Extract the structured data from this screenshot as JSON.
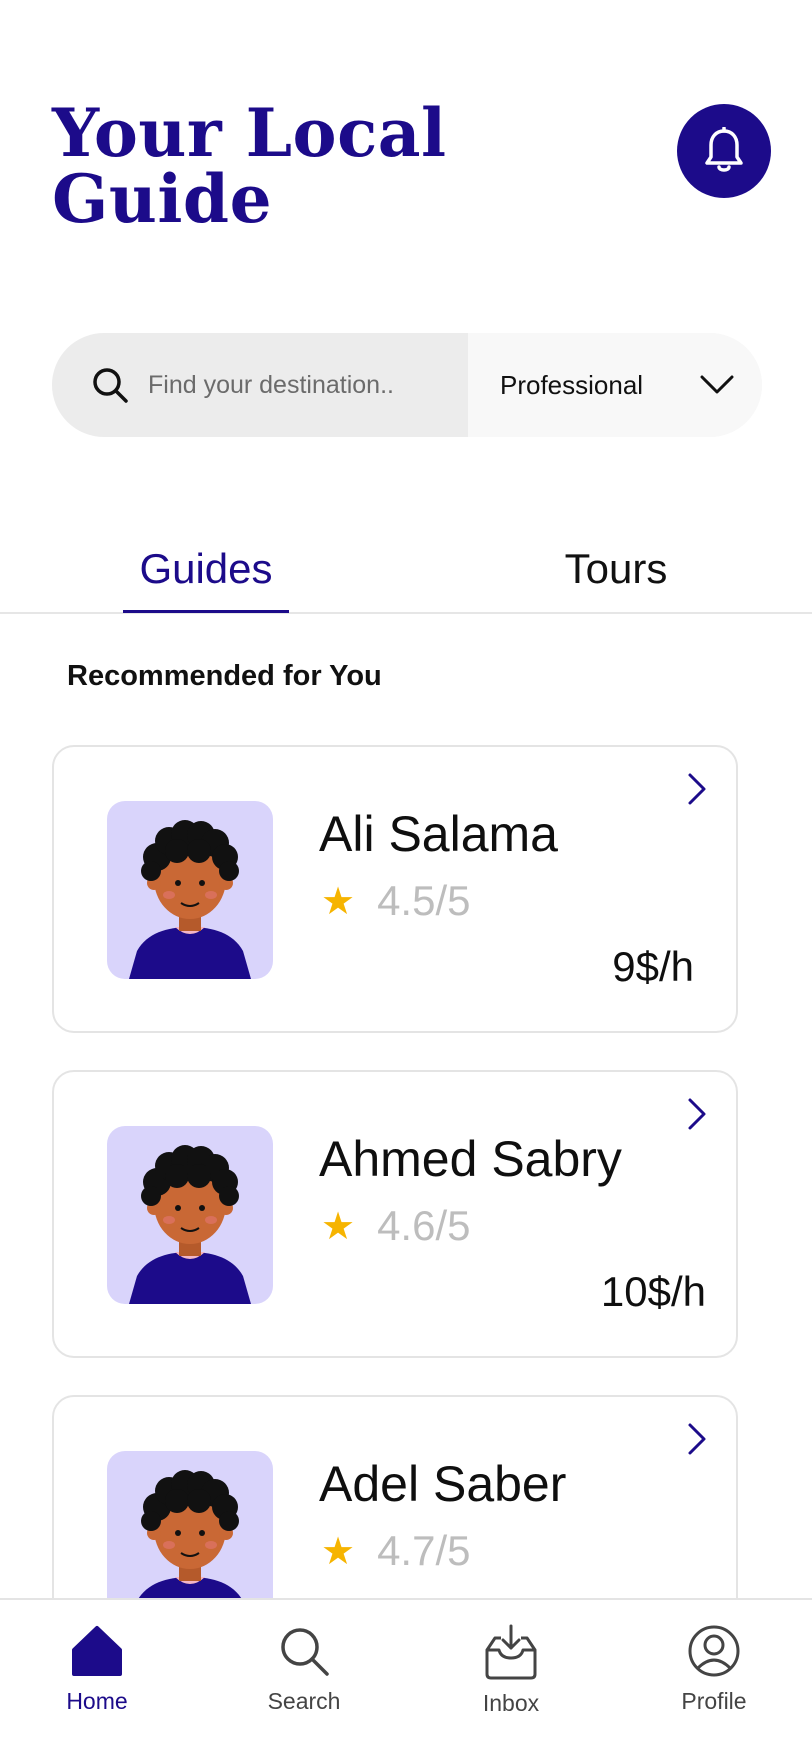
{
  "header": {
    "title_line1": "Your Local",
    "title_line2": "Guide",
    "notification_icon": "bell-icon"
  },
  "search": {
    "placeholder": "Find your destination..",
    "value": "",
    "category_selected": "Professional",
    "icon": "search-icon"
  },
  "tabs": [
    {
      "label": "Guides",
      "active": true
    },
    {
      "label": "Tours",
      "active": false
    }
  ],
  "section_title": "Recommended for You",
  "guides": [
    {
      "name": "Ali Salama",
      "rating": "4.5/5",
      "price": "9$/h"
    },
    {
      "name": "Ahmed Sabry",
      "rating": "4.6/5",
      "price": "10$/h"
    },
    {
      "name": "Adel Saber",
      "rating": "4.7/5",
      "price": ""
    }
  ],
  "nav": [
    {
      "label": "Home",
      "icon": "home-icon",
      "active": true
    },
    {
      "label": "Search",
      "icon": "search-icon",
      "active": false
    },
    {
      "label": "Inbox",
      "icon": "inbox-icon",
      "active": false
    },
    {
      "label": "Profile",
      "icon": "profile-icon",
      "active": false
    }
  ],
  "colors": {
    "brand": "#1c0b8a",
    "star": "#f6b400",
    "avatar_bg": "#d9d4fb"
  }
}
